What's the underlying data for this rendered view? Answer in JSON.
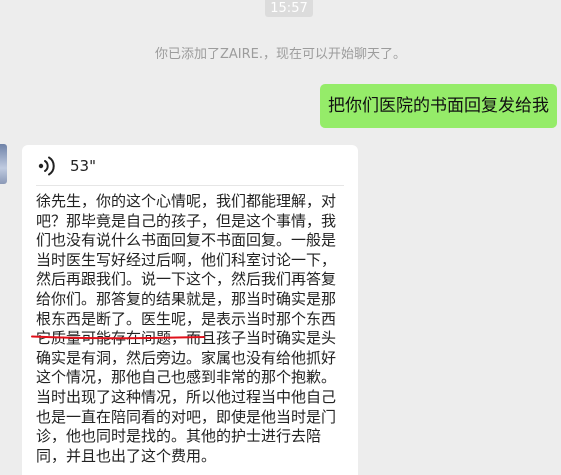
{
  "timestamp": "15:57",
  "system_notice": "你已添加了ZAIRE.，现在可以开始聊天了。",
  "sent_message": "把你们医院的书面回复发给我",
  "received": {
    "voice_duration": "53\"",
    "voice_icon": "voice-wave-icon",
    "transcript_lines": [
      "徐先生，你的这个心情呢，我们都能理解，对",
      "吧？那毕竟是自己的孩子，但是这个事情，我",
      "们也没有说什么书面回复不书面回复。一般是",
      "当时医生写好经过后啊，他们科室讨论一下，",
      "然后再跟我们。说一下这个，然后我们再答复",
      "给你们。那答复的结果就是，那当时确实是那",
      "根东西是断了。医生呢，是表示当时那个东西",
      "它质量可能存在问题，而且孩子当时确实是头",
      "确实是有洞，然后旁边。家属也没有给他抓好",
      "这个情况，那他自己也感到非常的那个抱歉。",
      "当时出现了这种情况，所以他过程当中他自己",
      "也是一直在陪同看的对吧，即使是他当时是门",
      "诊，他也同时是找的。其他的护士进行去陪",
      "同，并且也出了这个费用。"
    ]
  },
  "colors": {
    "background": "#ededed",
    "sent_bubble": "#95ec69",
    "received_bubble": "#ffffff",
    "underline": "#e0101a"
  }
}
